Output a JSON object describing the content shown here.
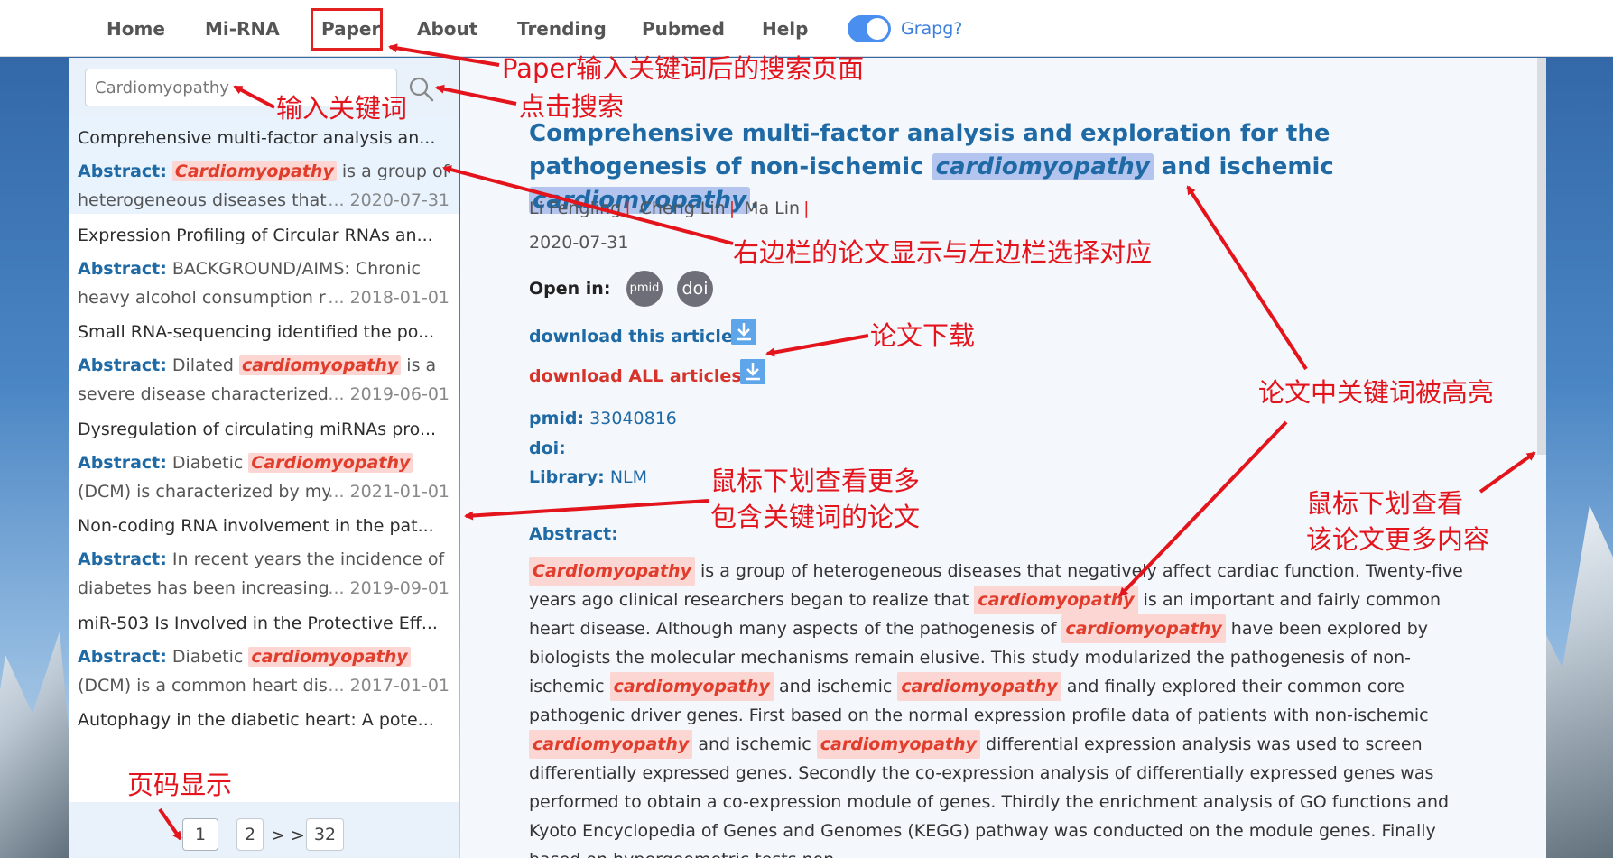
{
  "nav": {
    "items": [
      "Home",
      "Mi-RNA",
      "Paper",
      "About",
      "Trending",
      "Pubmed",
      "Help"
    ],
    "toggle_label": "Grapg?"
  },
  "sidebar": {
    "search_value": "Cardiomyopathy",
    "abstract_label": "Abstract:",
    "items": [
      {
        "title": "Comprehensive multi-factor analysis an...",
        "pre": "",
        "keyword": "Cardiomyopathy",
        "post": " is a group of",
        "line2": "heterogeneous diseases that",
        "date": "... 2020-07-31"
      },
      {
        "title": "Expression Profiling of Circular RNAs an...",
        "pre": " BACKGROUND/AIMS: Chronic",
        "keyword": "",
        "post": "",
        "line2": "heavy alcohol consumption r",
        "date": "... 2018-01-01"
      },
      {
        "title": "Small RNA-sequencing identified the po...",
        "pre": " Dilated ",
        "keyword": "cardiomyopathy",
        "post": " is a",
        "line2": "severe disease characterized",
        "date": "... 2019-06-01"
      },
      {
        "title": "Dysregulation of circulating miRNAs pro...",
        "pre": " Diabetic ",
        "keyword": "Cardiomyopathy",
        "post": "",
        "line2": "(DCM) is characterized by my",
        "date": "... 2021-01-01"
      },
      {
        "title": "Non-coding RNA involvement in the pat...",
        "pre": " In recent years the incidence of",
        "keyword": "",
        "post": "",
        "line2": "diabetes has been increasing",
        "date": "... 2019-09-01"
      },
      {
        "title": "miR-503 Is Involved in the Protective Eff...",
        "pre": " Diabetic ",
        "keyword": "cardiomyopathy",
        "post": "",
        "line2": "(DCM) is a common heart dis",
        "date": "... 2017-01-01"
      },
      {
        "title": "Autophagy in the diabetic heart: A pote...",
        "pre": "",
        "keyword": "",
        "post": "",
        "line2": "",
        "date": ""
      }
    ],
    "pager": {
      "current": "1",
      "next": "2",
      "arrows": "> >",
      "last": "32"
    }
  },
  "article": {
    "title_parts": [
      "Comprehensive multi-factor analysis and exploration for the pathogenesis of non-ischemic ",
      "cardiomyopathy",
      " and ischemic ",
      "cardiomyopathy",
      "."
    ],
    "authors": [
      "Li Fengling",
      "Cheng Lin",
      "Ma Lin"
    ],
    "author_sep": "|",
    "date": "2020-07-31",
    "open_in_label": "Open in:",
    "badges": [
      "pmid",
      "doi"
    ],
    "download_this": "download this article:",
    "download_all": "download ALL articles:",
    "pmid_label": "pmid:",
    "pmid_value": "33040816",
    "doi_label": "doi:",
    "library_label": "Library:",
    "library_value": "NLM",
    "abstract_label": "Abstract:",
    "abstract_parts": [
      {
        "t": "Cardiomyopathy",
        "hl": true
      },
      {
        "t": " is a group of heterogeneous diseases that negatively affect cardiac function. Twenty-five years ago clinical researchers began to realize that ",
        "hl": false
      },
      {
        "t": "cardiomyopathy",
        "hl": true
      },
      {
        "t": " is an important and fairly common heart disease. Although many aspects of the pathogenesis of ",
        "hl": false
      },
      {
        "t": "cardiomyopathy",
        "hl": true
      },
      {
        "t": " have been explored by biologists the molecular mechanisms remain elusive. This study modularized the pathogenesis of non-ischemic ",
        "hl": false
      },
      {
        "t": "cardiomyopathy",
        "hl": true
      },
      {
        "t": " and ischemic ",
        "hl": false
      },
      {
        "t": "cardiomyopathy",
        "hl": true
      },
      {
        "t": " and finally explored their common core pathogenic driver genes. First based on the normal expression profile data of patients with non-ischemic ",
        "hl": false
      },
      {
        "t": "cardiomyopathy",
        "hl": true
      },
      {
        "t": " and ischemic ",
        "hl": false
      },
      {
        "t": "cardiomyopathy",
        "hl": true
      },
      {
        "t": " differential expression analysis was used to screen differentially expressed genes. Secondly the co-expression analysis of differentially expressed genes was performed to obtain a co-expression module of genes. Thirdly the enrichment analysis of GO functions and Kyoto Encyclopedia of Genes and Genomes (KEGG) pathway was conducted on the module genes. Finally based on hypergeometric tests non-",
        "hl": false
      }
    ]
  },
  "annotations": {
    "paper_page": "Paper输入关键词后的搜索页面",
    "enter_keyword": "输入关键词",
    "click_search": "点击搜索",
    "right_matches_left": "右边栏的论文显示与左边栏选择对应",
    "download": "论文下载",
    "keyword_highlight": "论文中关键词被高亮",
    "scroll_more_1": "鼠标下划查看更多",
    "scroll_more_2": "包含关键词的论文",
    "scroll_article_1": "鼠标下划查看",
    "scroll_article_2": "该论文更多内容",
    "page_display": "页码显示",
    "color": "#e3141c"
  }
}
